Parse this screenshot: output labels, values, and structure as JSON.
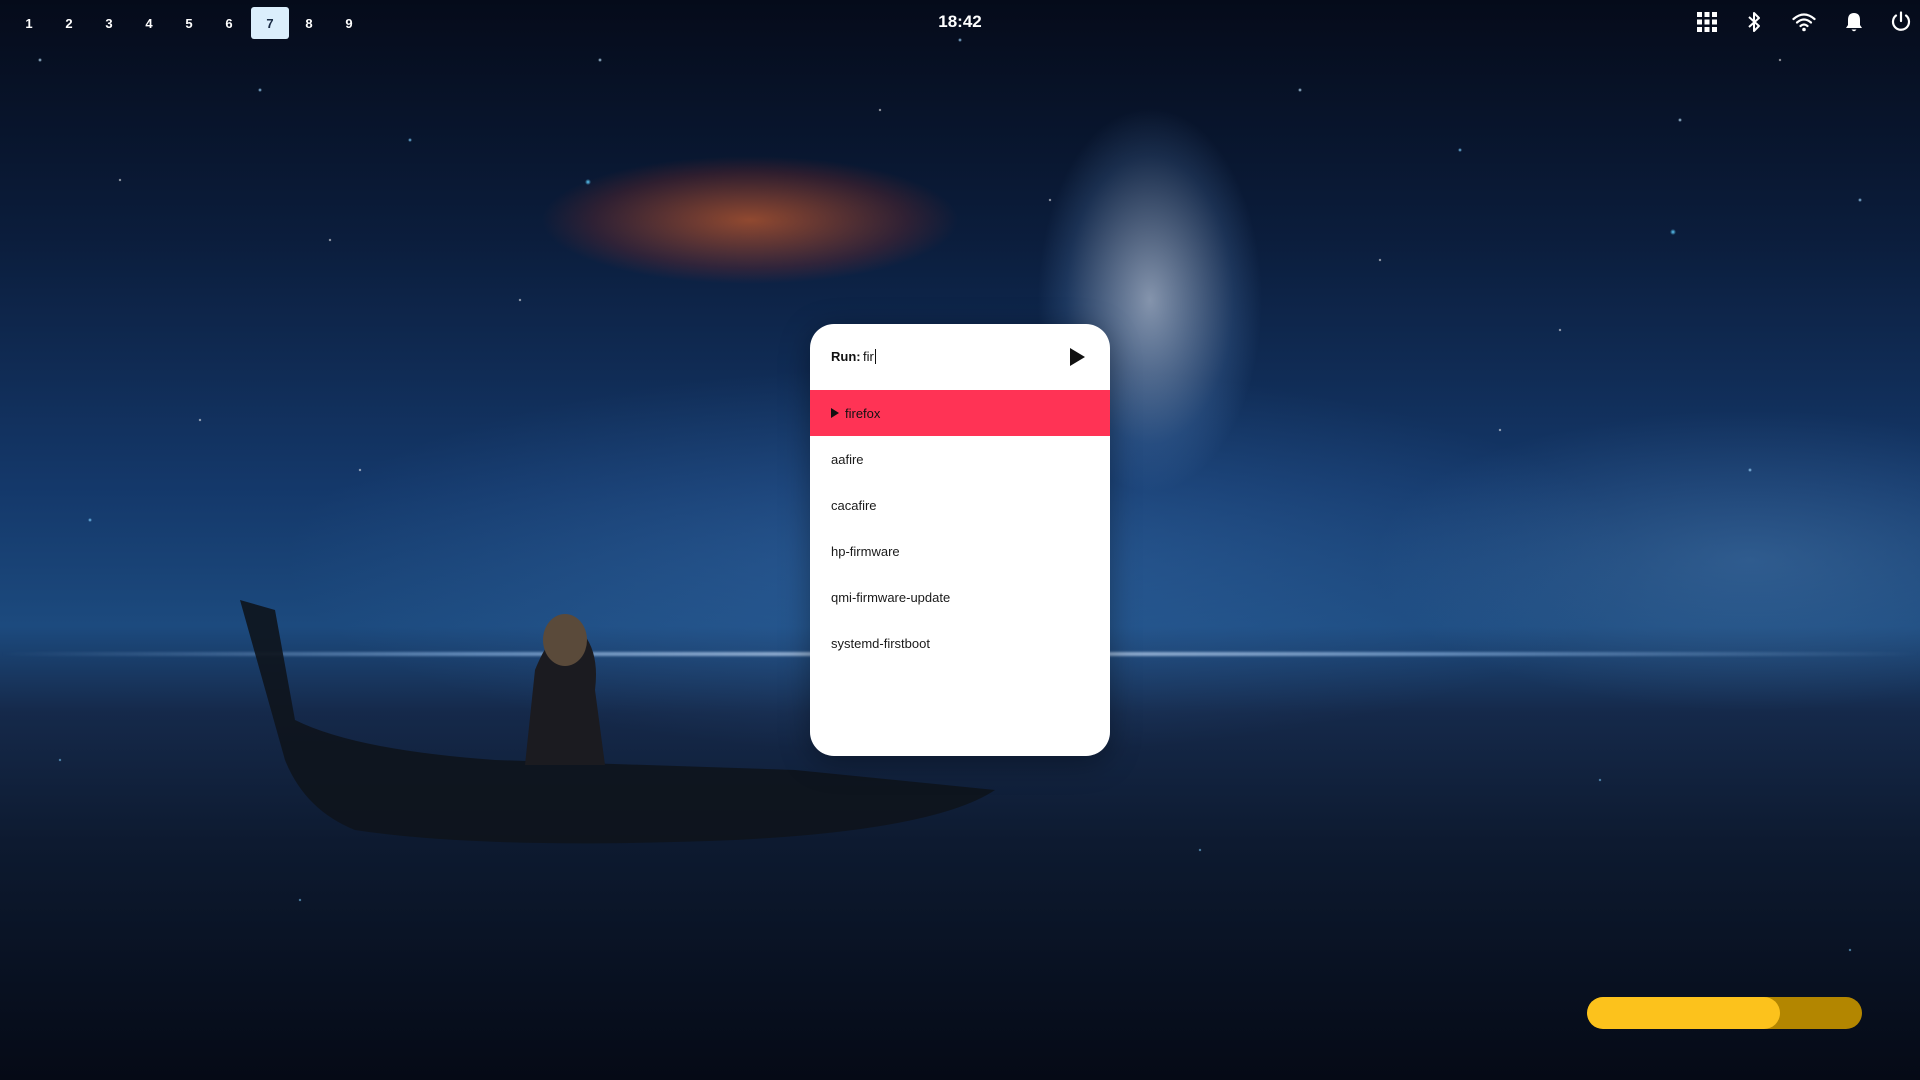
{
  "workspaces": {
    "items": [
      {
        "label": "1"
      },
      {
        "label": "2"
      },
      {
        "label": "3"
      },
      {
        "label": "4"
      },
      {
        "label": "5"
      },
      {
        "label": "6"
      },
      {
        "label": "7"
      },
      {
        "label": "8"
      },
      {
        "label": "9"
      }
    ],
    "active": "7"
  },
  "clock": {
    "time": "18:42"
  },
  "tray": {
    "icons": [
      "apps-grid-icon",
      "bluetooth-icon",
      "wifi-icon",
      "notification-bell-icon",
      "power-icon"
    ]
  },
  "launcher": {
    "prompt_label": "Run:",
    "input_value": "fir",
    "run_icon": "play-icon",
    "results": [
      {
        "label": "firefox",
        "selected": true
      },
      {
        "label": "aafire",
        "selected": false
      },
      {
        "label": "cacafire",
        "selected": false
      },
      {
        "label": "hp-firmware",
        "selected": false
      },
      {
        "label": "qmi-firmware-update",
        "selected": false
      },
      {
        "label": "systemd-firstboot",
        "selected": false
      }
    ],
    "selected_color": "#ff3355"
  },
  "battery": {
    "level_fraction": 0.7,
    "fill_color": "#fcc21c",
    "track_color": "#b38600"
  }
}
